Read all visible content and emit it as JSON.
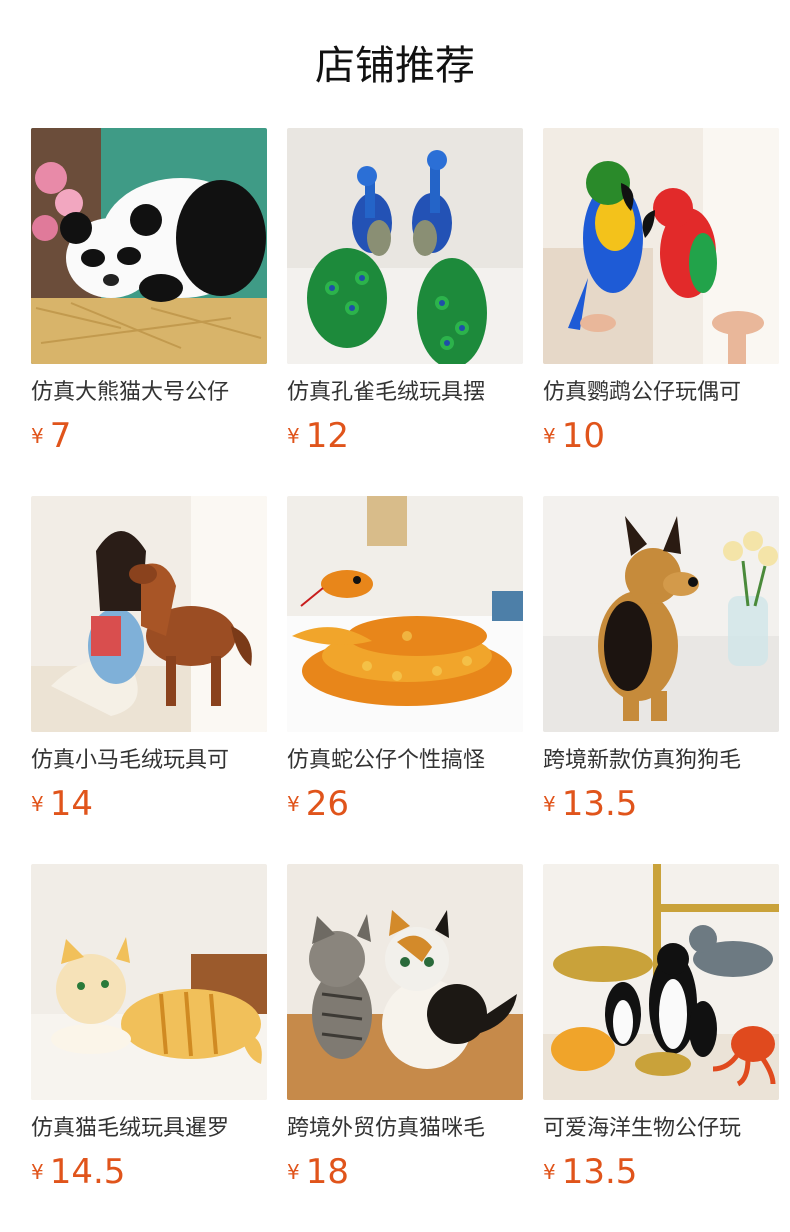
{
  "title": "店铺推荐",
  "currency_symbol": "¥",
  "accent_color": "#e0541b",
  "products": [
    {
      "name": "仿真大熊猫大号公仔",
      "price": "7",
      "image": "panda-plush"
    },
    {
      "name": "仿真孔雀毛绒玩具摆",
      "price": "12",
      "image": "peacock-plush"
    },
    {
      "name": "仿真鹦鹉公仔玩偶可",
      "price": "10",
      "image": "parrot-plush"
    },
    {
      "name": "仿真小马毛绒玩具可",
      "price": "14",
      "image": "horse-plush"
    },
    {
      "name": "仿真蛇公仔个性搞怪",
      "price": "26",
      "image": "snake-plush"
    },
    {
      "name": "跨境新款仿真狗狗毛",
      "price": "13.5",
      "image": "dog-plush"
    },
    {
      "name": "仿真猫毛绒玩具暹罗",
      "price": "14.5",
      "image": "cat-plush"
    },
    {
      "name": "跨境外贸仿真猫咪毛",
      "price": "18",
      "image": "kitten-plush"
    },
    {
      "name": "可爱海洋生物公仔玩",
      "price": "13.5",
      "image": "sea-animals-plush"
    }
  ]
}
